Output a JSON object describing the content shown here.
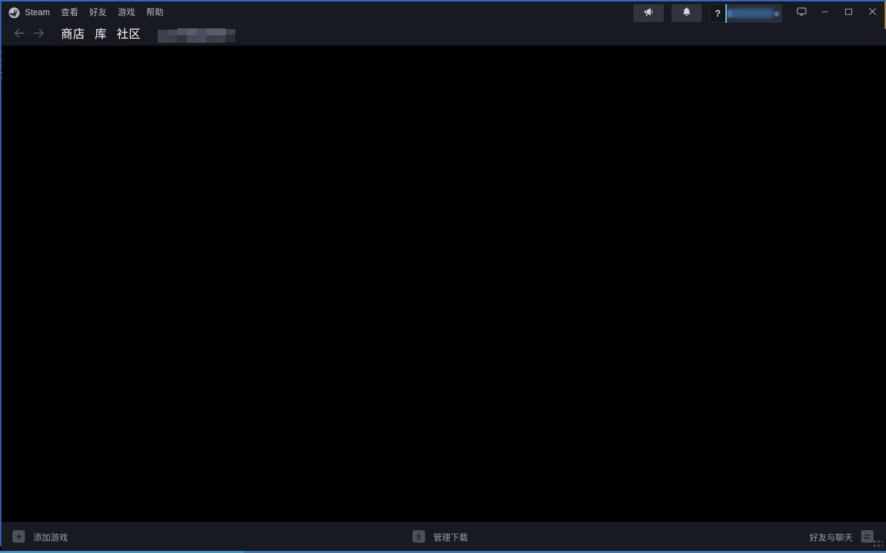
{
  "window": {
    "app_title": "Steam",
    "accent_border": "#2e9fd6",
    "header_bg": "#171a21",
    "content_bg": "#000000"
  },
  "menubar": {
    "logo_icon": "steam-logo-icon",
    "items": [
      {
        "label": "Steam",
        "icon": "steam-logo-icon"
      },
      {
        "label": "查看"
      },
      {
        "label": "好友"
      },
      {
        "label": "游戏"
      },
      {
        "label": "帮助"
      }
    ]
  },
  "toolbar": {
    "announcements": {
      "label": "",
      "icon": "megaphone-icon"
    },
    "notifications": {
      "label": "",
      "icon": "bell-icon"
    },
    "help": {
      "label": "?",
      "icon": "question-mark-icon"
    },
    "account": {
      "name": "",
      "redacted": true,
      "caret_icon": "chevron-down-icon"
    },
    "big_picture": {
      "label": "",
      "icon": "display-icon"
    },
    "minimize": {
      "label": "",
      "icon": "minimize-icon"
    },
    "maximize": {
      "label": "",
      "icon": "maximize-icon"
    },
    "close": {
      "label": "",
      "icon": "close-icon"
    }
  },
  "nav": {
    "back": {
      "icon": "arrow-left-icon"
    },
    "forward": {
      "icon": "arrow-right-icon"
    },
    "links": [
      {
        "label": "商店",
        "name": "store"
      },
      {
        "label": "库",
        "name": "library"
      },
      {
        "label": "社区",
        "name": "community"
      }
    ],
    "redacted_item": {
      "label": "",
      "redacted": true
    }
  },
  "footer": {
    "add_game": {
      "label": "添加游戏",
      "icon": "plus-icon"
    },
    "manage_downloads": {
      "label": "管理下载",
      "icon": "download-icon"
    },
    "friends_and_chat": {
      "label": "好友与聊天",
      "icon": "friends-icon"
    },
    "resize_grip": {
      "icon": "resize-grip-icon"
    }
  }
}
